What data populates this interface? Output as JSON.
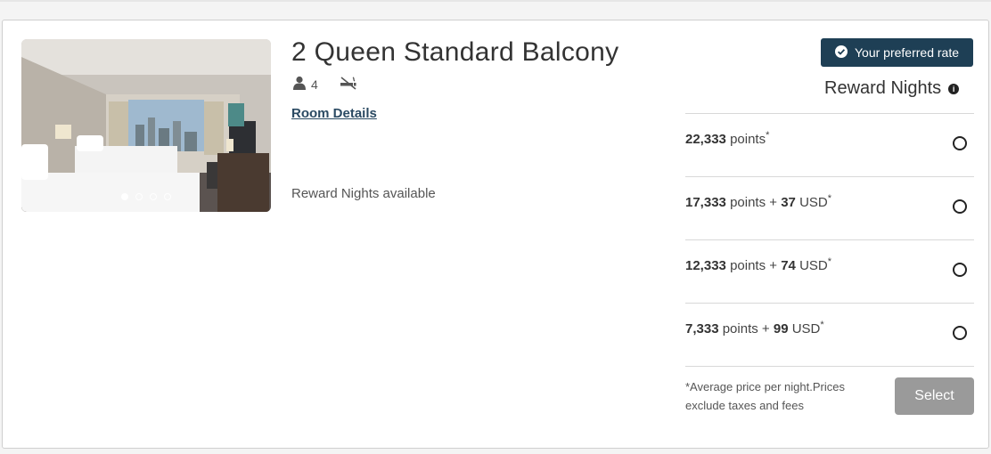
{
  "room": {
    "title": "2 Queen Standard Balcony",
    "occupancy": "4",
    "details_link": "Room Details",
    "availability_text": "Reward Nights available"
  },
  "carousel": {
    "slide_count": 4,
    "active_index": 0
  },
  "icons": {
    "guests": "person-icon",
    "smoking": "no-smoking-icon",
    "badge": "check-circle-icon",
    "info": "info-icon"
  },
  "badge": {
    "label": "Your preferred rate",
    "color": "#1e3f55"
  },
  "rates": {
    "header": "Reward Nights",
    "options": [
      {
        "points": "22,333",
        "points_label": "points",
        "plus": "",
        "cash": "",
        "currency": "",
        "asterisk": "*"
      },
      {
        "points": "17,333",
        "points_label": "points",
        "plus": "+",
        "cash": "37",
        "currency": "USD",
        "asterisk": "*"
      },
      {
        "points": "12,333",
        "points_label": "points",
        "plus": "+",
        "cash": "74",
        "currency": "USD",
        "asterisk": "*"
      },
      {
        "points": "7,333",
        "points_label": "points",
        "plus": "+",
        "cash": "99",
        "currency": "USD",
        "asterisk": "*"
      }
    ],
    "disclaimer": "*Average price per night.Prices exclude taxes and fees",
    "select_label": "Select"
  },
  "colors": {
    "link": "#2b4a63",
    "select_disabled": "#9a9a9a"
  }
}
